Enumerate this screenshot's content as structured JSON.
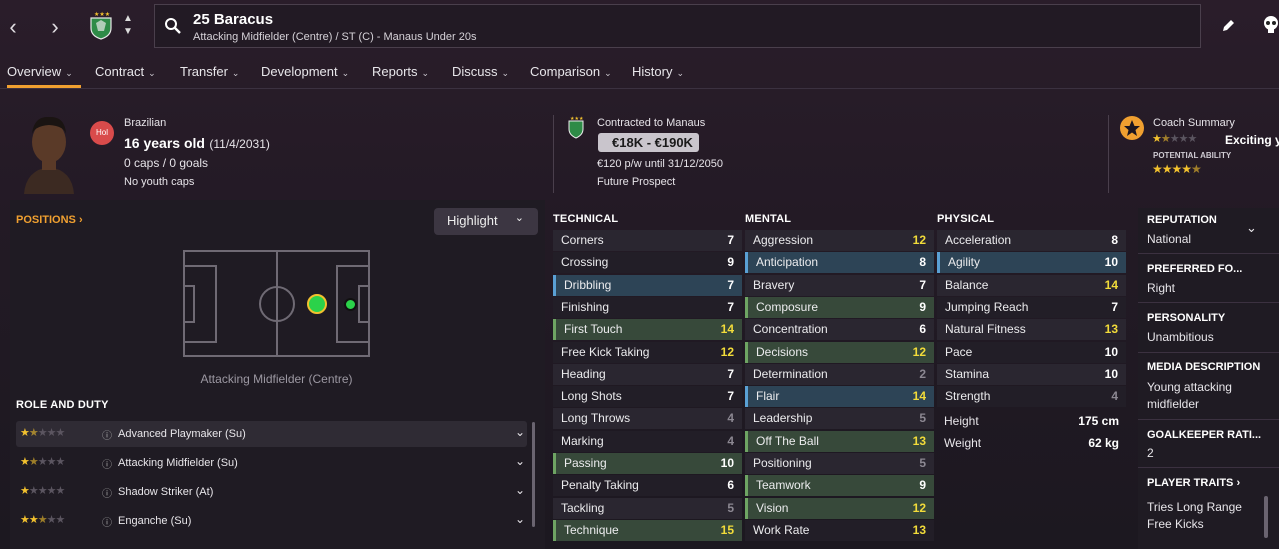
{
  "header": {
    "player_title": "25 Baracus",
    "player_subtitle": "Attacking Midfielder (Centre) / ST (C) - Manaus Under 20s"
  },
  "tabs": [
    {
      "label": "Overview"
    },
    {
      "label": "Contract"
    },
    {
      "label": "Transfer"
    },
    {
      "label": "Development"
    },
    {
      "label": "Reports"
    },
    {
      "label": "Discuss"
    },
    {
      "label": "Comparison"
    },
    {
      "label": "History"
    }
  ],
  "player": {
    "nationality": "Brazilian",
    "badge": "Hol",
    "age": "16 years old",
    "dob": "(11/4/2031)",
    "caps": "0 caps / 0 goals",
    "youth_caps": "No youth caps"
  },
  "contract": {
    "label": "Contracted to Manaus",
    "value_range": "€18K - €190K",
    "wage": "€120 p/w until 31/12/2050",
    "status": "Future Prospect"
  },
  "coach": {
    "label": "Coach Summary",
    "summary": "Exciting y",
    "potential_label": "POTENTIAL ABILITY",
    "current_stars": 1.5,
    "potential_stars": 4.5
  },
  "positions": {
    "title": "POSITIONS",
    "highlight_label": "Highlight",
    "position_caption": "Attacking Midfielder (Centre)"
  },
  "roles": {
    "title": "ROLE AND DUTY",
    "items": [
      {
        "label": "Advanced Playmaker (Su)",
        "stars": 1.5
      },
      {
        "label": "Attacking Midfielder (Su)",
        "stars": 1.5
      },
      {
        "label": "Shadow Striker (At)",
        "stars": 1
      },
      {
        "label": "Enganche (Su)",
        "stars": 2.5
      }
    ]
  },
  "technical": {
    "title": "TECHNICAL",
    "rows": [
      {
        "name": "Corners",
        "value": "7"
      },
      {
        "name": "Crossing",
        "value": "9"
      },
      {
        "name": "Dribbling",
        "value": "7"
      },
      {
        "name": "Finishing",
        "value": "7"
      },
      {
        "name": "First Touch",
        "value": "14"
      },
      {
        "name": "Free Kick Taking",
        "value": "12"
      },
      {
        "name": "Heading",
        "value": "7"
      },
      {
        "name": "Long Shots",
        "value": "7"
      },
      {
        "name": "Long Throws",
        "value": "4"
      },
      {
        "name": "Marking",
        "value": "4"
      },
      {
        "name": "Passing",
        "value": "10"
      },
      {
        "name": "Penalty Taking",
        "value": "6"
      },
      {
        "name": "Tackling",
        "value": "5"
      },
      {
        "name": "Technique",
        "value": "15"
      }
    ]
  },
  "mental": {
    "title": "MENTAL",
    "rows": [
      {
        "name": "Aggression",
        "value": "12"
      },
      {
        "name": "Anticipation",
        "value": "8"
      },
      {
        "name": "Bravery",
        "value": "7"
      },
      {
        "name": "Composure",
        "value": "9"
      },
      {
        "name": "Concentration",
        "value": "6"
      },
      {
        "name": "Decisions",
        "value": "12"
      },
      {
        "name": "Determination",
        "value": "2"
      },
      {
        "name": "Flair",
        "value": "14"
      },
      {
        "name": "Leadership",
        "value": "5"
      },
      {
        "name": "Off The Ball",
        "value": "13"
      },
      {
        "name": "Positioning",
        "value": "5"
      },
      {
        "name": "Teamwork",
        "value": "9"
      },
      {
        "name": "Vision",
        "value": "12"
      },
      {
        "name": "Work Rate",
        "value": "13"
      }
    ]
  },
  "physical": {
    "title": "PHYSICAL",
    "rows": [
      {
        "name": "Acceleration",
        "value": "8"
      },
      {
        "name": "Agility",
        "value": "10"
      },
      {
        "name": "Balance",
        "value": "14"
      },
      {
        "name": "Jumping Reach",
        "value": "7"
      },
      {
        "name": "Natural Fitness",
        "value": "13"
      },
      {
        "name": "Pace",
        "value": "10"
      },
      {
        "name": "Stamina",
        "value": "10"
      },
      {
        "name": "Strength",
        "value": "4"
      }
    ],
    "height_label": "Height",
    "height": "175 cm",
    "weight_label": "Weight",
    "weight": "62 kg"
  },
  "sidebar": {
    "reputation_label": "REPUTATION",
    "reputation": "National",
    "foot_label": "PREFERRED FO...",
    "foot": "Right",
    "personality_label": "PERSONALITY",
    "personality": "Unambitious",
    "media_label": "MEDIA DESCRIPTION",
    "media_1": "Young attacking",
    "media_2": "midfielder",
    "gk_label": "GOALKEEPER RATI...",
    "gk": "2",
    "traits_label": "PLAYER TRAITS",
    "trait_1": "Tries Long Range",
    "trait_2": "Free Kicks"
  },
  "colors": {
    "accent": "#f0a030",
    "highlight_green": "#37493a",
    "highlight_blue": "#2d4456",
    "value_yellow": "#f2dc3a"
  }
}
